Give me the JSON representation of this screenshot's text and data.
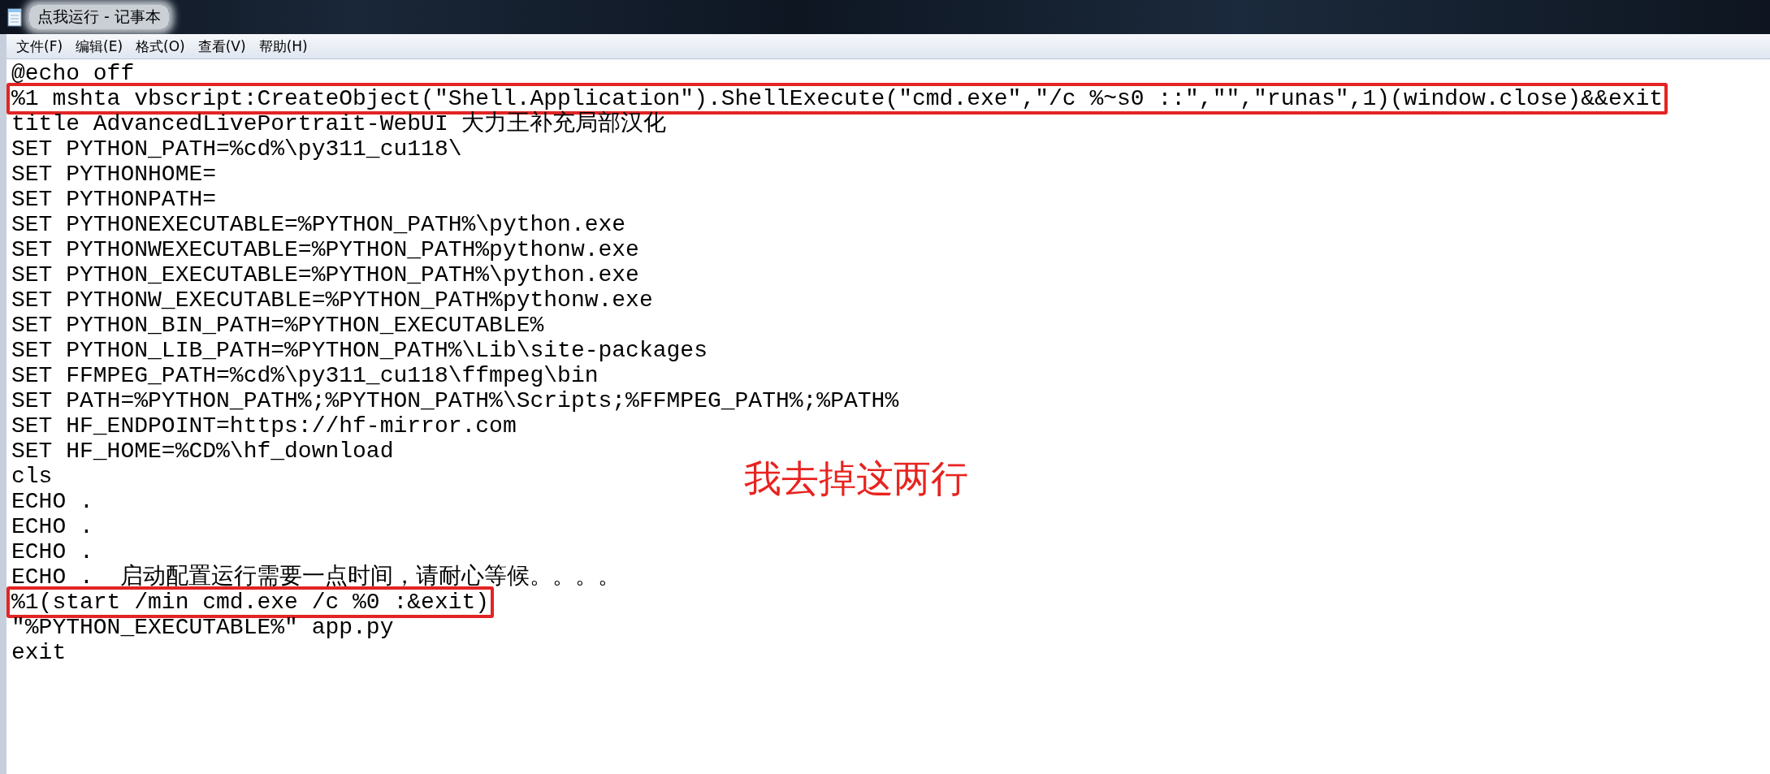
{
  "window": {
    "title": "点我运行 - 记事本"
  },
  "menu": [
    "文件(F)",
    "编辑(E)",
    "格式(O)",
    "查看(V)",
    "帮助(H)"
  ],
  "lines": [
    {
      "text": "@echo off",
      "highlighted": false
    },
    {
      "text": "%1 mshta vbscript:CreateObject(\"Shell.Application\").ShellExecute(\"cmd.exe\",\"/c %~s0 ::\",\"\",\"runas\",1)(window.close)&&exit",
      "highlighted": true
    },
    {
      "text": "title AdvancedLivePortrait-WebUI 大力王补充局部汉化",
      "highlighted": false
    },
    {
      "text": "SET PYTHON_PATH=%cd%\\py311_cu118\\",
      "highlighted": false
    },
    {
      "text": "SET PYTHONHOME=",
      "highlighted": false
    },
    {
      "text": "SET PYTHONPATH=",
      "highlighted": false
    },
    {
      "text": "SET PYTHONEXECUTABLE=%PYTHON_PATH%\\python.exe",
      "highlighted": false
    },
    {
      "text": "SET PYTHONWEXECUTABLE=%PYTHON_PATH%pythonw.exe",
      "highlighted": false
    },
    {
      "text": "SET PYTHON_EXECUTABLE=%PYTHON_PATH%\\python.exe",
      "highlighted": false
    },
    {
      "text": "SET PYTHONW_EXECUTABLE=%PYTHON_PATH%pythonw.exe",
      "highlighted": false
    },
    {
      "text": "SET PYTHON_BIN_PATH=%PYTHON_EXECUTABLE%",
      "highlighted": false
    },
    {
      "text": "SET PYTHON_LIB_PATH=%PYTHON_PATH%\\Lib\\site-packages",
      "highlighted": false
    },
    {
      "text": "SET FFMPEG_PATH=%cd%\\py311_cu118\\ffmpeg\\bin",
      "highlighted": false
    },
    {
      "text": "SET PATH=%PYTHON_PATH%;%PYTHON_PATH%\\Scripts;%FFMPEG_PATH%;%PATH%",
      "highlighted": false
    },
    {
      "text": "SET HF_ENDPOINT=https://hf-mirror.com",
      "highlighted": false
    },
    {
      "text": "SET HF_HOME=%CD%\\hf_download",
      "highlighted": false
    },
    {
      "text": "cls",
      "highlighted": false
    },
    {
      "text": "ECHO .",
      "highlighted": false
    },
    {
      "text": "ECHO .",
      "highlighted": false
    },
    {
      "text": "ECHO .",
      "highlighted": false
    },
    {
      "text": "ECHO .  启动配置运行需要一点时间，请耐心等候。。。。",
      "highlighted": false
    },
    {
      "text": "%1(start /min cmd.exe /c %0 :&exit)",
      "highlighted": true
    },
    {
      "text": "\"%PYTHON_EXECUTABLE%\" app.py",
      "highlighted": false
    },
    {
      "text": "exit",
      "highlighted": false
    }
  ],
  "annotation": "我去掉这两行"
}
